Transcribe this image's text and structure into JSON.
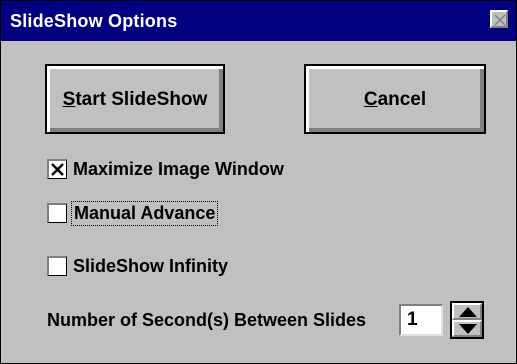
{
  "window": {
    "title": "SlideShow Options",
    "close_icon": "close-x-icon"
  },
  "buttons": {
    "start_first": "S",
    "start_rest": "tart SlideShow",
    "cancel_first": "C",
    "cancel_rest": "ancel"
  },
  "options": [
    {
      "label": "Maximize Image Window",
      "checked": true
    },
    {
      "label": "Manual Advance",
      "checked": false
    },
    {
      "label": "SlideShow Infinity",
      "checked": false
    }
  ],
  "seconds": {
    "label": "Number of Second(s) Between Slides",
    "value": "1",
    "spinner_icons": [
      "arrow-up-icon",
      "arrow-down-icon"
    ]
  },
  "colors": {
    "titlebar": "#000080",
    "face": "#c0c0c0"
  }
}
